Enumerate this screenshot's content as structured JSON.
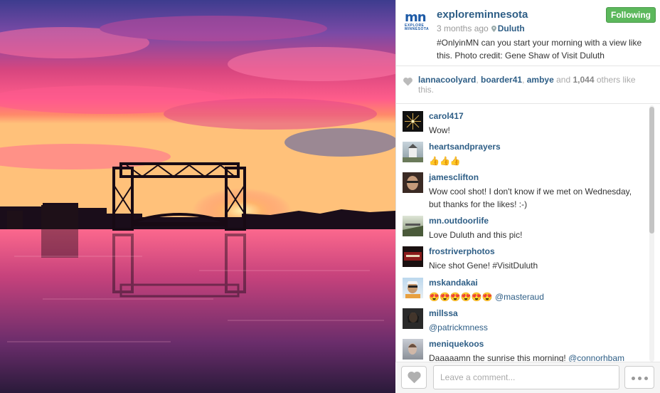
{
  "post": {
    "username": "exploreminnesota",
    "follow_label": "Following",
    "time": "3 months ago",
    "location": "Duluth",
    "caption": "#OnlyinMN can you start your morning with a view like this. Photo credit: Gene Shaw of Visit Duluth",
    "logo": {
      "mn": "mn",
      "line1": "EXPLORE",
      "line2": "MINNESOTA"
    }
  },
  "likes": {
    "users": [
      "lannacoolyard",
      "boarder41",
      "ambye"
    ],
    "sep1": ", ",
    "sep2": ", ",
    "and_text": " and ",
    "count": "1,044",
    "suffix": " others like this."
  },
  "comments": [
    {
      "user": "carol417",
      "text": "Wow!",
      "mention": ""
    },
    {
      "user": "heartsandprayers",
      "text": "👍👍👍",
      "mention": ""
    },
    {
      "user": "jamesclifton",
      "text": "Wow cool shot! I don't know if we met on Wednesday, but thanks for the likes! :-)",
      "mention": ""
    },
    {
      "user": "mn.outdoorlife",
      "text": "Love Duluth and this pic!",
      "mention": ""
    },
    {
      "user": "frostriverphotos",
      "text": "Nice shot Gene! #VisitDuluth",
      "mention": ""
    },
    {
      "user": "mskandakai",
      "text": "😍😍😍😍😍😍 ",
      "mention": "@masteraud"
    },
    {
      "user": "millssa",
      "text": "",
      "mention": "@patrickmness"
    },
    {
      "user": "meniquekoos",
      "text": "Daaaaamn the sunrise this morning! ",
      "mention": "@connorhbam"
    }
  ],
  "composer": {
    "placeholder": "Leave a comment..."
  },
  "icons": {
    "heart": "heart-icon",
    "pin": "location-pin-icon",
    "more": "more-options-icon"
  },
  "colors": {
    "link": "#2e5e86",
    "follow_green": "#5cb85c",
    "sky_pink": "#e0528a",
    "sky_purple": "#5a4aa0"
  }
}
